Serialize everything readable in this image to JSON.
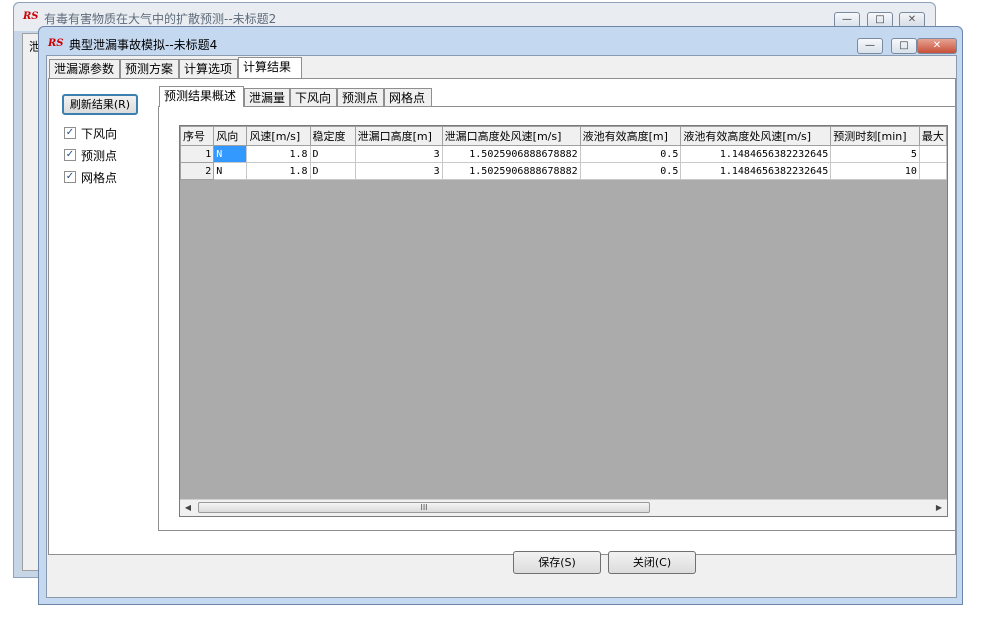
{
  "bg_window": {
    "title": "有毒有害物质在大气中的扩散预测--未标题2",
    "client_label": "泄"
  },
  "main_window": {
    "title": "典型泄漏事故模拟--未标题4"
  },
  "app_logo": "RS",
  "main_tabs": [
    "泄漏源参数",
    "预测方案",
    "计算选项",
    "计算结果"
  ],
  "refresh_button": "刷新结果(R)",
  "checkboxes": [
    {
      "label": "下风向",
      "checked": true
    },
    {
      "label": "预测点",
      "checked": true
    },
    {
      "label": "网格点",
      "checked": true
    }
  ],
  "sub_tabs": [
    "预测结果概述",
    "泄漏量",
    "下风向",
    "预测点",
    "网格点"
  ],
  "table": {
    "columns": [
      "序号",
      "风向",
      "风速[m/s]",
      "稳定度",
      "泄漏口高度[m]",
      "泄漏口高度处风速[m/s]",
      "液池有效高度[m]",
      "液池有效高度处风速[m/s]",
      "预测时刻[min]",
      "最大"
    ],
    "rows": [
      [
        "1",
        "N",
        "1.8",
        "D",
        "3",
        "1.5025906888678882",
        "0.5",
        "1.1484656382232645",
        "5",
        ""
      ],
      [
        "2",
        "N",
        "1.8",
        "D",
        "3",
        "1.5025906888678882",
        "0.5",
        "1.1484656382232645",
        "10",
        ""
      ]
    ]
  },
  "scroll_thumb": "III",
  "save_button": "保存(S)",
  "close_button": "关闭(C)",
  "colors": {
    "selection": "#3399ff",
    "grid_bg": "#ababab",
    "frame": "#c4d8ef"
  }
}
